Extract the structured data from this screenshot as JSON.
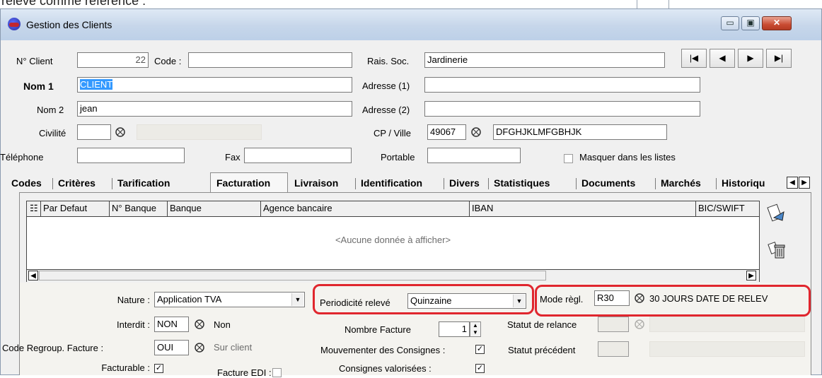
{
  "window": {
    "title": "Gestion des Clients",
    "minimize_symbol": "▭",
    "maximize_symbol": "▣",
    "close_symbol": "✕",
    "top_caption_fragment": "relevé comme référence :"
  },
  "nav_buttons": [
    "|◀",
    "◀",
    "▶",
    "▶|"
  ],
  "header": {
    "n_client_label": "N° Client",
    "n_client_value": "22",
    "code_label": "Code :",
    "code_value": "",
    "rais_soc_label": "Rais. Soc.",
    "rais_soc_value": "Jardinerie",
    "nom1_label": "Nom 1",
    "nom1_value": "CLIENT",
    "adresse1_label": "Adresse (1)",
    "adresse1_value": "",
    "nom2_label": "Nom 2",
    "nom2_value": "jean",
    "adresse2_label": "Adresse (2)",
    "adresse2_value": "",
    "civilite_label": "Civilité",
    "civilite_value": "",
    "cpville_label": "CP / Ville",
    "cp_value": "49067",
    "ville_value": "DFGHJKLMFGBHJK",
    "telephone_label": "Téléphone",
    "telephone_value": "",
    "fax_label": "Fax",
    "fax_value": "",
    "portable_label": "Portable",
    "portable_value": "",
    "masquer_label": "Masquer dans les listes"
  },
  "tabs": [
    "Codes",
    "Critères",
    "Tarification",
    "Facturation",
    "Livraison",
    "Identification",
    "Divers",
    "Statistiques",
    "Documents",
    "Marchés",
    "Historiqu"
  ],
  "active_tab": "Facturation",
  "grid": {
    "columns": [
      "Par Defaut",
      "N° Banque",
      "Banque",
      "Agence bancaire",
      "IBAN",
      "BIC/SWIFT"
    ],
    "empty_text": "<Aucune donnée à afficher>"
  },
  "billing": {
    "nature_label": "Nature :",
    "nature_value": "Application TVA",
    "periodicite_label": "Periodicité relevé",
    "periodicite_value": "Quinzaine",
    "mode_label": "Mode règl.",
    "mode_code": "R30",
    "mode_desc": "30 JOURS DATE DE RELEV",
    "interdit_label": "Interdit :",
    "interdit_code": "NON",
    "interdit_desc": "Non",
    "nombre_facture_label": "Nombre Facture",
    "nombre_facture_value": "1",
    "statut_relance_label": "Statut de relance",
    "code_regroup_label": "Code Regroup. Facture :",
    "code_regroup_code": "OUI",
    "code_regroup_desc": "Sur client",
    "mouvementer_label": "Mouvementer des Consignes :",
    "mouvementer_checked": "✓",
    "statut_precedent_label": "Statut précédent",
    "facturable_label": "Facturable :",
    "facturable_checked": "✓",
    "facture_edi_label": "Facture EDI :",
    "consignes_valorisees_label": "Consignes valorisées :",
    "consignes_checked": "✓"
  },
  "colors": {
    "highlight": "#e0262e",
    "selection": "#3399ff"
  }
}
